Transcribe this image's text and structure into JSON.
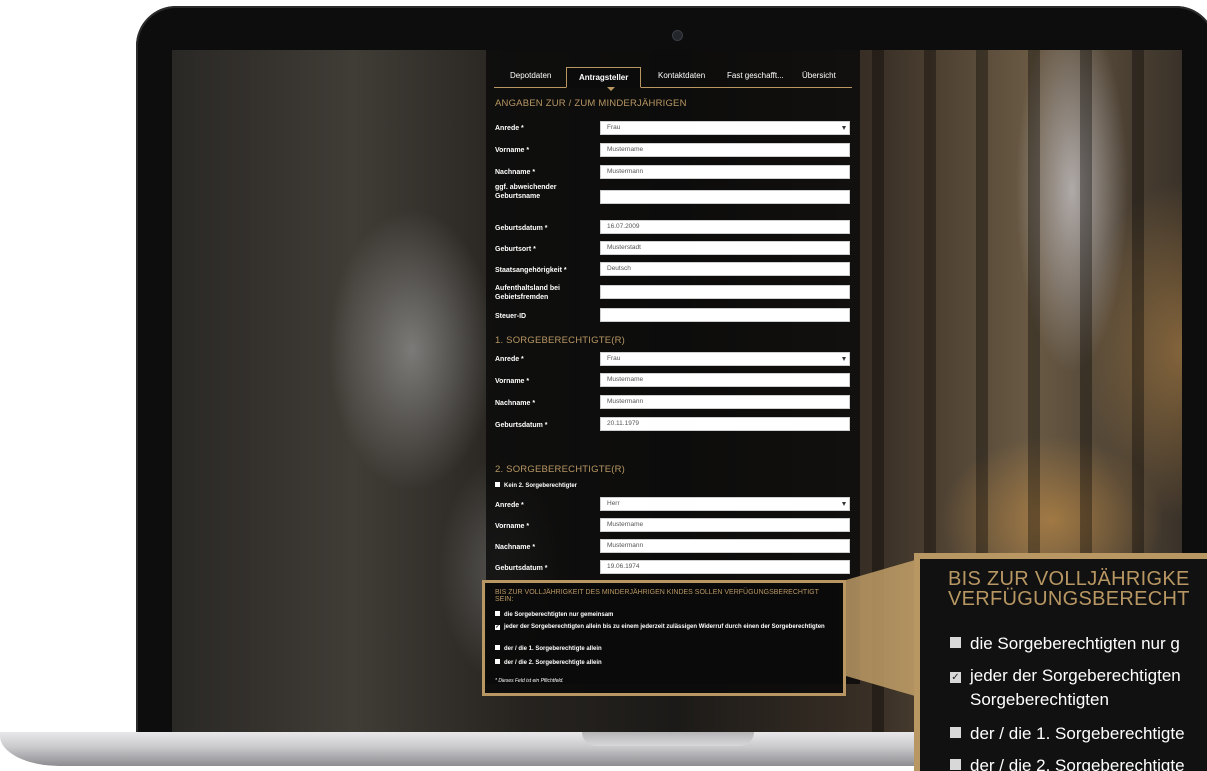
{
  "tabs": [
    {
      "label": "Depotdaten"
    },
    {
      "label": "Antragsteller"
    },
    {
      "label": "Kontaktdaten"
    },
    {
      "label": "Fast geschafft..."
    },
    {
      "label": "Übersicht"
    }
  ],
  "active_tab": "Antragsteller",
  "minor": {
    "title": "ANGABEN ZUR / ZUM MINDERJÄHRIGEN",
    "anrede": {
      "label": "Anrede *",
      "value": "Frau"
    },
    "vorname": {
      "label": "Vorname *",
      "value": "Mustername"
    },
    "nachname": {
      "label": "Nachname *",
      "value": "Mustermann"
    },
    "geburtsname": {
      "label": "ggf. abweichender Geburtsname",
      "value": ""
    },
    "geburtsdatum": {
      "label": "Geburtsdatum *",
      "value": "16.07.2009"
    },
    "geburtsort": {
      "label": "Geburtsort *",
      "value": "Musterstadt"
    },
    "staatsangehoerigkeit": {
      "label": "Staatsangehörigkeit *",
      "value": "Deutsch"
    },
    "aufenthaltsland": {
      "label": "Aufenthaltsland bei Gebietsfremden",
      "value": ""
    },
    "steuer_id": {
      "label": "Steuer-ID",
      "value": ""
    }
  },
  "guardian1": {
    "title": "1. SORGEBERECHTIGTE(R)",
    "anrede": {
      "label": "Anrede *",
      "value": "Frau"
    },
    "vorname": {
      "label": "Vorname *",
      "value": "Mustername"
    },
    "nachname": {
      "label": "Nachname *",
      "value": "Mustermann"
    },
    "geburtsdatum": {
      "label": "Geburtsdatum *",
      "value": "20.11.1979"
    }
  },
  "guardian2": {
    "title": "2. SORGEBERECHTIGTE(R)",
    "no_second_label": "Kein 2. Sorgeberechtigter",
    "anrede": {
      "label": "Anrede *",
      "value": "Herr"
    },
    "vorname": {
      "label": "Vorname *",
      "value": "Mustername"
    },
    "nachname": {
      "label": "Nachname *",
      "value": "Mustermann"
    },
    "geburtsdatum": {
      "label": "Geburtsdatum *",
      "value": "19.06.1974"
    }
  },
  "authority": {
    "title": "BIS ZUR VOLLJÄHRIGKEIT DES MINDERJÄHRIGEN KINDES SOLLEN VERFÜGUNGSBERECHTIGT SEIN:",
    "options": [
      {
        "label": "die Sorgeberechtigten nur gemeinsam",
        "checked": false
      },
      {
        "label": "jeder der Sorgeberechtigten allein bis zu einem jederzeit zulässigen Widerruf durch einen der Sorgeberechtigten",
        "checked": true
      },
      {
        "label": "der / die 1. Sorgeberechtigte allein",
        "checked": false
      },
      {
        "label": "der / die 2. Sorgeberechtigte allein",
        "checked": false
      }
    ],
    "footnote": "* Dieses Feld ist ein Pflichtfeld."
  },
  "zoom": {
    "title_line1": "BIS ZUR VOLLJÄHRIGKE",
    "title_line2": "VERFÜGUNGSBERECHT",
    "row1": "die Sorgeberechtigten nur g",
    "row2a": "jeder der Sorgeberechtigten",
    "row2b": "Sorgeberechtigten",
    "row3": "der / die 1. Sorgeberechtigte",
    "row4": "der / die 2. Sorgeberechtigte"
  },
  "colors": {
    "accent": "#b89763",
    "panel": "#0a0a0a"
  }
}
